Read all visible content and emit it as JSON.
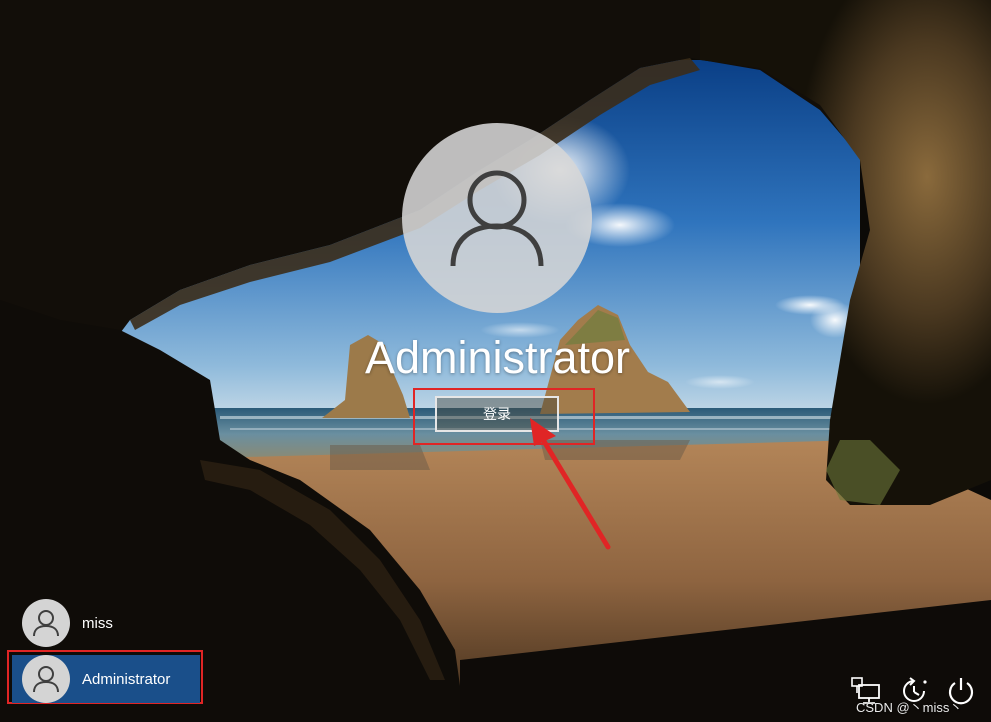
{
  "login": {
    "user_name": "Administrator",
    "signin_button_label": "登录"
  },
  "user_list": [
    {
      "name": "miss",
      "selected": false
    },
    {
      "name": "Administrator",
      "selected": true
    }
  ],
  "tray": {
    "network_icon": "network-icon",
    "ease_of_access_icon": "ease-of-access-icon",
    "power_icon": "power-icon"
  },
  "watermark": "CSDN @丶miss丶",
  "colors": {
    "annotation_red": "#e02525",
    "selected_user_blue": "#1a4f8a",
    "avatar_gray": "#d4d4d4"
  }
}
